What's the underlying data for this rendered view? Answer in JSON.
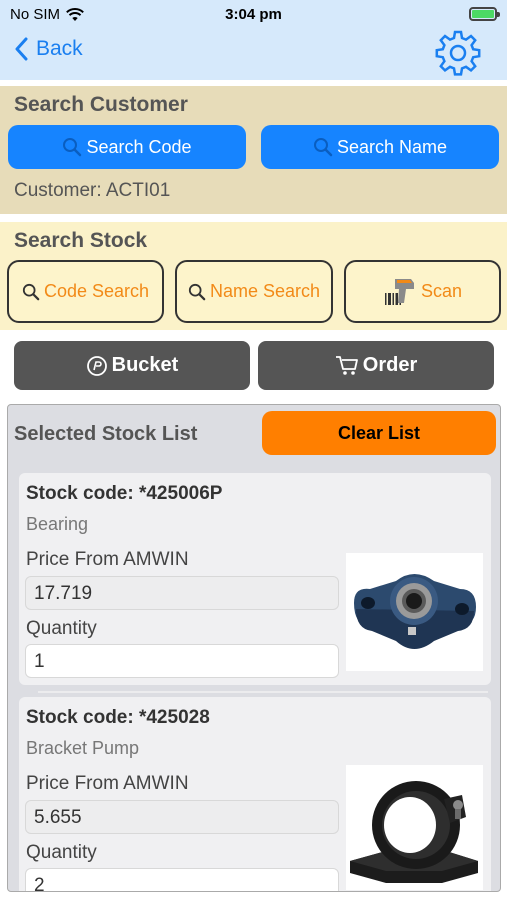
{
  "status_bar": {
    "carrier": "No SIM",
    "time": "3:04 pm"
  },
  "nav": {
    "back_label": "Back"
  },
  "customer_section": {
    "title": "Search Customer",
    "search_code_label": "Search Code",
    "search_name_label": "Search Name",
    "customer_line": "Customer: ACTI01"
  },
  "stock_section": {
    "title": "Search Stock",
    "code_search_label": "Code Search",
    "name_search_label": "Name Search",
    "scan_label": "Scan"
  },
  "actions": {
    "bucket_label": "Bucket",
    "order_label": "Order"
  },
  "list": {
    "title": "Selected Stock List",
    "clear_label": "Clear List",
    "items": [
      {
        "code": "Stock code: *425006P",
        "description": "Bearing",
        "price_label": "Price From AMWIN",
        "price": "17.719",
        "quantity_label": "Quantity",
        "quantity": "1"
      },
      {
        "code": "Stock code: *425028",
        "description": "Bracket Pump",
        "price_label": "Price From AMWIN",
        "price": "5.655",
        "quantity_label": "Quantity",
        "quantity": "2"
      }
    ]
  },
  "colors": {
    "nav_bg": "#d6e9fb",
    "accent_blue": "#1684ff",
    "customer_bg": "#e7dcb9",
    "stock_bg": "#fbf2c9",
    "stock_btn_text": "#f28a18",
    "dark_button": "#555555",
    "clear_button": "#ff7f00"
  }
}
